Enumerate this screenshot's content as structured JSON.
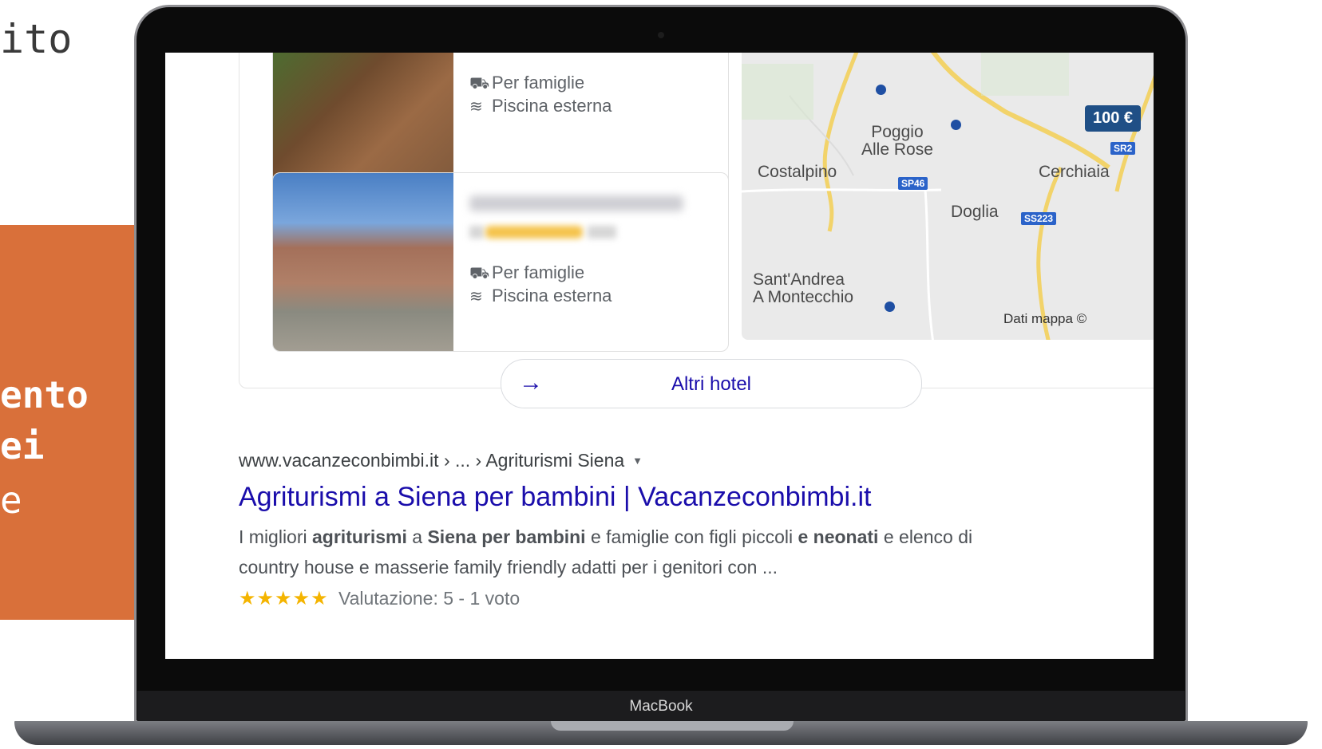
{
  "slide": {
    "title_fragment": "ito",
    "panel_lines": [
      "ento",
      "ei",
      "e"
    ]
  },
  "laptop": {
    "label": "MacBook"
  },
  "hotels": [
    {
      "amenities": [
        "Per famiglie",
        "Piscina esterna"
      ]
    },
    {
      "amenities": [
        "Per famiglie",
        "Piscina esterna"
      ]
    }
  ],
  "map": {
    "places": [
      "Poggio",
      "Alle Rose",
      "Costalpino",
      "Cerchiaia",
      "Doglia",
      "Sant'Andrea",
      "A Montecchio"
    ],
    "roads": [
      "SP46",
      "SS223",
      "SR2"
    ],
    "price": "100 €",
    "attribution": "Dati mappa ©"
  },
  "more_hotels": {
    "label": "Altri hotel"
  },
  "result": {
    "breadcrumb": "www.vacanzeconbimbi.it › ... › Agriturismi Siena",
    "title": "Agriturismi a Siena per bambini | Vacanzeconbimbi.it",
    "snippet_line1": [
      "I migliori ",
      "agriturismi",
      " a ",
      "Siena per bambini",
      " e famiglie con figli piccoli ",
      "e neonati",
      " e elenco di"
    ],
    "snippet_line2": "country house e masserie family friendly adatti per i genitori con ...",
    "stars": "★★★★★",
    "rating": "Valutazione: 5 - 1 voto"
  }
}
